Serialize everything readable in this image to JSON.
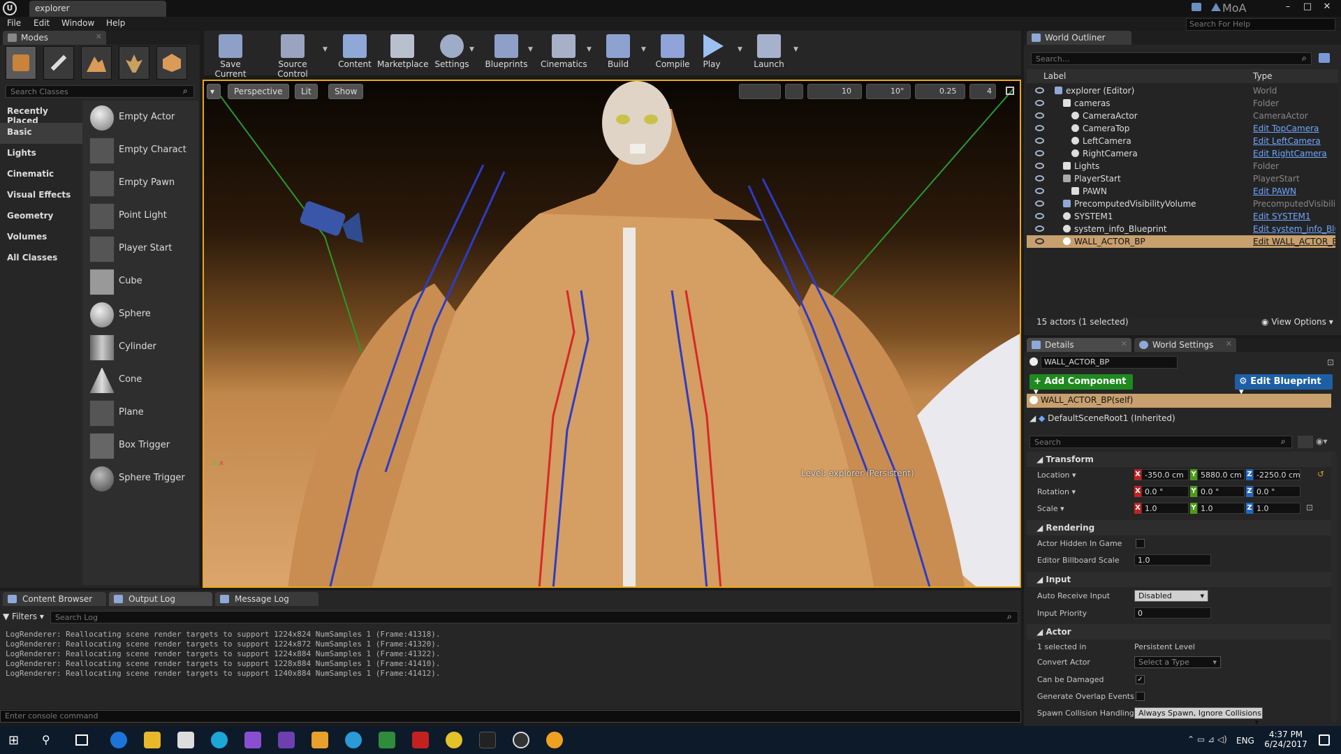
{
  "title_bar": {
    "doc_tab": "explorer",
    "user": "MoA"
  },
  "menu": {
    "items": [
      "File",
      "Edit",
      "Window",
      "Help"
    ],
    "help_search_placeholder": "Search For Help"
  },
  "modes": {
    "tab_label": "Modes",
    "search_placeholder": "Search Classes",
    "categories": [
      "Recently Placed",
      "Basic",
      "Lights",
      "Cinematic",
      "Visual Effects",
      "Geometry",
      "Volumes",
      "All Classes"
    ],
    "selected_category": "Basic",
    "items": [
      "Empty Actor",
      "Empty Charact",
      "Empty Pawn",
      "Point Light",
      "Player Start",
      "Cube",
      "Sphere",
      "Cylinder",
      "Cone",
      "Plane",
      "Box Trigger",
      "Sphere Trigger"
    ]
  },
  "toolbar": {
    "buttons": [
      "Save Current",
      "Source Control",
      "Content",
      "Marketplace",
      "Settings",
      "Blueprints",
      "Cinematics",
      "Build",
      "Compile",
      "Play",
      "Launch"
    ]
  },
  "viewport": {
    "perspective": "Perspective",
    "lit": "Lit",
    "show": "Show",
    "grid_snap": "10",
    "rotation_snap": "10°",
    "scale_snap": "0.25",
    "camera_speed": "4",
    "level_prefix": "Level:",
    "level_name": "explorer (Persistent)"
  },
  "bottom_tabs": [
    "Content Browser",
    "Output Log",
    "Message Log"
  ],
  "output_log": {
    "filters_label": "Filters",
    "search_placeholder": "Search Log",
    "lines": [
      "LogRenderer: Reallocating scene render targets to support 1224x824 NumSamples 1 (Frame:41318).",
      "LogRenderer: Reallocating scene render targets to support 1224x872 NumSamples 1 (Frame:41320).",
      "LogRenderer: Reallocating scene render targets to support 1224x884 NumSamples 1 (Frame:41322).",
      "LogRenderer: Reallocating scene render targets to support 1228x884 NumSamples 1 (Frame:41410).",
      "LogRenderer: Reallocating scene render targets to support 1240x884 NumSamples 1 (Frame:41412)."
    ],
    "console_placeholder": "Enter console command"
  },
  "world_outliner": {
    "tab_label": "World Outliner",
    "search_placeholder": "Search...",
    "col_label": "Label",
    "col_type": "Type",
    "rows": [
      {
        "label": "explorer (Editor)",
        "type": "World",
        "link": false
      },
      {
        "label": "cameras",
        "type": "Folder",
        "link": false
      },
      {
        "label": "CameraActor",
        "type": "CameraActor",
        "link": false
      },
      {
        "label": "CameraTop",
        "type": "Edit TopCamera",
        "link": true
      },
      {
        "label": "LeftCamera",
        "type": "Edit LeftCamera",
        "link": true
      },
      {
        "label": "RightCamera",
        "type": "Edit RightCamera",
        "link": true
      },
      {
        "label": "Lights",
        "type": "Folder",
        "link": false
      },
      {
        "label": "PlayerStart",
        "type": "PlayerStart",
        "link": false
      },
      {
        "label": "PAWN",
        "type": "Edit PAWN",
        "link": true
      },
      {
        "label": "PrecomputedVisibilityVolume",
        "type": "PrecomputedVisibility",
        "link": false
      },
      {
        "label": "SYSTEM1",
        "type": "Edit SYSTEM1",
        "link": true
      },
      {
        "label": "system_info_Blueprint",
        "type": "Edit system_info_Blu",
        "link": true
      },
      {
        "label": "WALL_ACTOR_BP",
        "type": "Edit WALL_ACTOR_B",
        "link": true
      }
    ],
    "status": "15 actors (1 selected)",
    "view_options": "View Options"
  },
  "details": {
    "tab_label": "Details",
    "tab2_label": "World Settings",
    "actor_name": "WALL_ACTOR_BP",
    "add_component": "+ Add Component",
    "edit_blueprint": "Edit Blueprint",
    "component_self": "WALL_ACTOR_BP(self)",
    "component_root": "DefaultSceneRoot1 (Inherited)",
    "search_placeholder": "Search",
    "transform": {
      "header": "Transform",
      "location_label": "Location",
      "rotation_label": "Rotation",
      "scale_label": "Scale",
      "location": [
        "-350.0 cm",
        "5880.0 cm",
        "-2250.0 cm"
      ],
      "rotation": [
        "0.0 °",
        "0.0 °",
        "0.0 °"
      ],
      "scale": [
        "1.0",
        "1.0",
        "1.0"
      ]
    },
    "rendering": {
      "header": "Rendering",
      "hidden_label": "Actor Hidden In Game",
      "billboard_label": "Editor Billboard Scale",
      "billboard_value": "1.0"
    },
    "input": {
      "header": "Input",
      "auto_receive_label": "Auto Receive Input",
      "auto_receive_value": "Disabled",
      "priority_label": "Input Priority",
      "priority_value": "0"
    },
    "actor": {
      "header": "Actor",
      "selected_in": "1 selected in",
      "persistent_level": "Persistent Level",
      "convert_label": "Convert Actor",
      "convert_value": "Select a Type",
      "damaged_label": "Can be Damaged",
      "overlap_label": "Generate Overlap Events D",
      "spawn_label": "Spawn Collision Handling M",
      "spawn_value": "Always Spawn, Ignore Collisions"
    }
  },
  "taskbar": {
    "time": "4:37 PM",
    "date": "6/24/2017",
    "lang": "ENG"
  },
  "colors": {
    "accent": "#e8a817",
    "add_component": "#1e8a1e",
    "edit_blueprint": "#1d5fa6",
    "selection": "#c8a06e"
  }
}
